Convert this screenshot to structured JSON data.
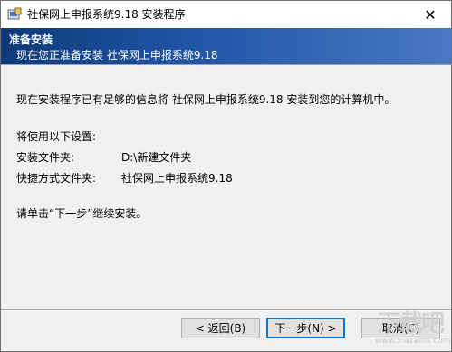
{
  "window": {
    "title": "社保网上申报系统9.18 安装程序",
    "close_glyph": "✕"
  },
  "banner": {
    "title": "准备安装",
    "subtitle": "现在您正准备安装 社保网上申报系统9.18"
  },
  "content": {
    "intro": "现在安装程序已有足够的信息将 社保网上申报系统9.18 安装到您的计算机中。",
    "settings_heading": "将使用以下设置:",
    "install_folder_label": "安装文件夹:",
    "install_folder_value": "D:\\新建文件夹",
    "shortcut_folder_label": "快捷方式文件夹:",
    "shortcut_folder_value": "社保网上申报系统9.18",
    "instruction": "请单击“下一步”继续安装。"
  },
  "buttons": {
    "back": "< 返回(B)",
    "next": "下一步(N) >",
    "cancel": "取消(C)"
  },
  "watermark": {
    "glyphs": "下载吧",
    "url": "www.xiazaiba.com"
  }
}
